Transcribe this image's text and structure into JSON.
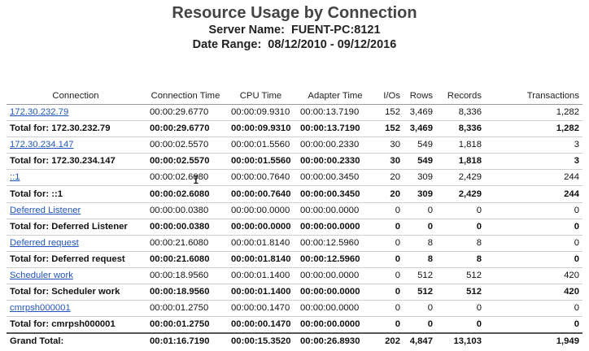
{
  "report": {
    "title": "Resource Usage by Connection",
    "server_label": "Server Name:",
    "server_value": "FUENT-PC:8121",
    "date_label": "Date Range:",
    "date_value": "08/12/2010 - 09/12/2016"
  },
  "columns": [
    "Connection",
    "Connection Time",
    "CPU Time",
    "Adapter Time",
    "I/Os",
    "Rows",
    "Records",
    "Transactions"
  ],
  "rows": [
    {
      "type": "link",
      "label": "172.30.232.79",
      "conn_time": "00:00:29.6770",
      "cpu_time": "00:00:09.9310",
      "adapter_time": "00:00:13.7190",
      "ios": "152",
      "rows": "3,469",
      "records": "8,336",
      "transactions": "1,282"
    },
    {
      "type": "total",
      "label": "Total for:  172.30.232.79",
      "conn_time": "00:00:29.6770",
      "cpu_time": "00:00:09.9310",
      "adapter_time": "00:00:13.7190",
      "ios": "152",
      "rows": "3,469",
      "records": "8,336",
      "transactions": "1,282"
    },
    {
      "type": "link",
      "label": "172.30.234.147",
      "conn_time": "00:00:02.5570",
      "cpu_time": "00:00:01.5560",
      "adapter_time": "00:00:00.2330",
      "ios": "30",
      "rows": "549",
      "records": "1,818",
      "transactions": "3"
    },
    {
      "type": "total",
      "label": "Total for:  172.30.234.147",
      "conn_time": "00:00:02.5570",
      "cpu_time": "00:00:01.5560",
      "adapter_time": "00:00:00.2330",
      "ios": "30",
      "rows": "549",
      "records": "1,818",
      "transactions": "3"
    },
    {
      "type": "link",
      "label": "::1",
      "conn_time": "00:00:02.6080",
      "cpu_time": "00:00:00.7640",
      "adapter_time": "00:00:00.3450",
      "ios": "20",
      "rows": "309",
      "records": "2,429",
      "transactions": "244"
    },
    {
      "type": "total",
      "label": "Total for:  ::1",
      "conn_time": "00:00:02.6080",
      "cpu_time": "00:00:00.7640",
      "adapter_time": "00:00:00.3450",
      "ios": "20",
      "rows": "309",
      "records": "2,429",
      "transactions": "244"
    },
    {
      "type": "link",
      "label": "Deferred Listener",
      "conn_time": "00:00:00.0380",
      "cpu_time": "00:00:00.0000",
      "adapter_time": "00:00:00.0000",
      "ios": "0",
      "rows": "0",
      "records": "0",
      "transactions": "0"
    },
    {
      "type": "total",
      "label": "Total for:  Deferred Listener",
      "conn_time": "00:00:00.0380",
      "cpu_time": "00:00:00.0000",
      "adapter_time": "00:00:00.0000",
      "ios": "0",
      "rows": "0",
      "records": "0",
      "transactions": "0"
    },
    {
      "type": "link",
      "label": "Deferred request",
      "conn_time": "00:00:21.6080",
      "cpu_time": "00:00:01.8140",
      "adapter_time": "00:00:12.5960",
      "ios": "0",
      "rows": "8",
      "records": "8",
      "transactions": "0"
    },
    {
      "type": "total",
      "label": "Total for:  Deferred request",
      "conn_time": "00:00:21.6080",
      "cpu_time": "00:00:01.8140",
      "adapter_time": "00:00:12.5960",
      "ios": "0",
      "rows": "8",
      "records": "8",
      "transactions": "0"
    },
    {
      "type": "link",
      "label": "Scheduler work",
      "conn_time": "00:00:18.9560",
      "cpu_time": "00:00:01.1400",
      "adapter_time": "00:00:00.0000",
      "ios": "0",
      "rows": "512",
      "records": "512",
      "transactions": "420"
    },
    {
      "type": "total",
      "label": "Total for:  Scheduler work",
      "conn_time": "00:00:18.9560",
      "cpu_time": "00:00:01.1400",
      "adapter_time": "00:00:00.0000",
      "ios": "0",
      "rows": "512",
      "records": "512",
      "transactions": "420"
    },
    {
      "type": "link",
      "label": "cmrpsh000001",
      "conn_time": "00:00:01.2750",
      "cpu_time": "00:00:00.1470",
      "adapter_time": "00:00:00.0000",
      "ios": "0",
      "rows": "0",
      "records": "0",
      "transactions": "0"
    },
    {
      "type": "total",
      "label": "Total for:  cmrpsh000001",
      "conn_time": "00:00:01.2750",
      "cpu_time": "00:00:00.1470",
      "adapter_time": "00:00:00.0000",
      "ios": "0",
      "rows": "0",
      "records": "0",
      "transactions": "0"
    },
    {
      "type": "grand",
      "label": "Grand Total:",
      "conn_time": "00:01:16.7190",
      "cpu_time": "00:00:15.3520",
      "adapter_time": "00:00:26.8930",
      "ios": "202",
      "rows": "4,847",
      "records": "13,103",
      "transactions": "1,949"
    }
  ],
  "colors": {
    "link": "#2255bb",
    "title": "#444444"
  },
  "icons": {
    "cursor": "text-cursor-icon"
  }
}
